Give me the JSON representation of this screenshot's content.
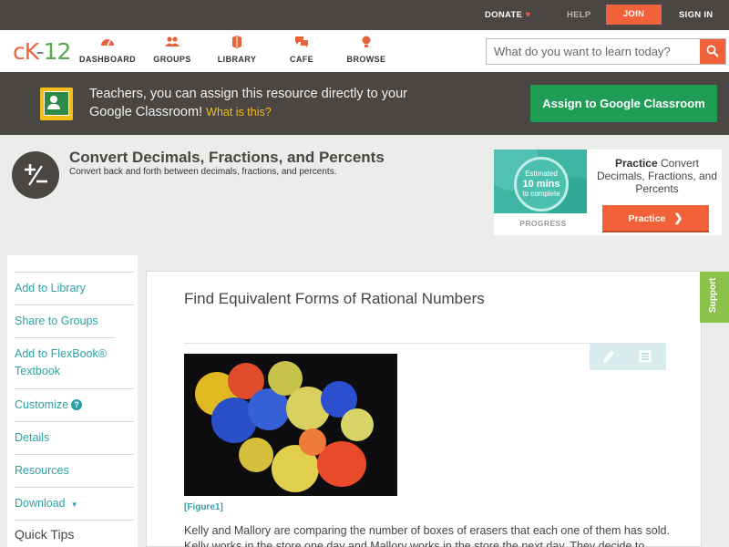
{
  "topbar": {
    "donate_label": "DONATE",
    "help_label": "HELP",
    "join_label": "JOIN",
    "signin_label": "SIGN IN"
  },
  "nav": {
    "logo_c": "c",
    "logo_k": "K",
    "logo_dash": "-",
    "logo_num": "12",
    "items": [
      {
        "label": "DASHBOARD",
        "icon": "dashboard-icon"
      },
      {
        "label": "GROUPS",
        "icon": "groups-icon"
      },
      {
        "label": "LIBRARY",
        "icon": "library-icon"
      },
      {
        "label": "CAFE",
        "icon": "cafe-icon"
      },
      {
        "label": "BROWSE",
        "icon": "browse-icon"
      }
    ],
    "search_placeholder": "What do you want to learn today?"
  },
  "banner": {
    "text": "Teachers, you can assign this resource directly to your Google Classroom!",
    "link": "What is this?",
    "button": "Assign to Google Classroom"
  },
  "header": {
    "title": "Convert Decimals, Fractions, and Percents",
    "subtitle": "Convert back and forth between decimals, fractions, and percents."
  },
  "practice_card": {
    "estimated": "Estimated",
    "mins": "10 mins",
    "to_complete": "to complete",
    "progress_label": "PROGRESS",
    "practice_bold": "Practice",
    "practice_topic": "Convert Decimals, Fractions, and Percents",
    "button": "Practice"
  },
  "sidebar": {
    "items": [
      {
        "label": "Add to Library"
      },
      {
        "label": "Share to Groups"
      },
      {
        "label": "Add to FlexBook® Textbook"
      },
      {
        "label": "Customize"
      },
      {
        "label": "Details"
      },
      {
        "label": "Resources"
      },
      {
        "label": "Download"
      }
    ],
    "quick_tips": "Quick Tips"
  },
  "content": {
    "title": "Find Equivalent Forms of Rational Numbers",
    "figure_caption": "[Figure1]",
    "paragraph": "Kelly and Mallory are comparing the number of boxes of erasers that each one of them has sold. Kelly works in the store one day and Mallory works in the store the next day. They decide to"
  },
  "support_tab": "Support",
  "colors": {
    "accent_orange": "#f2623a",
    "teal_link": "#2ea1a6",
    "google_green": "#1f9d55",
    "dark_bar": "#494643"
  }
}
